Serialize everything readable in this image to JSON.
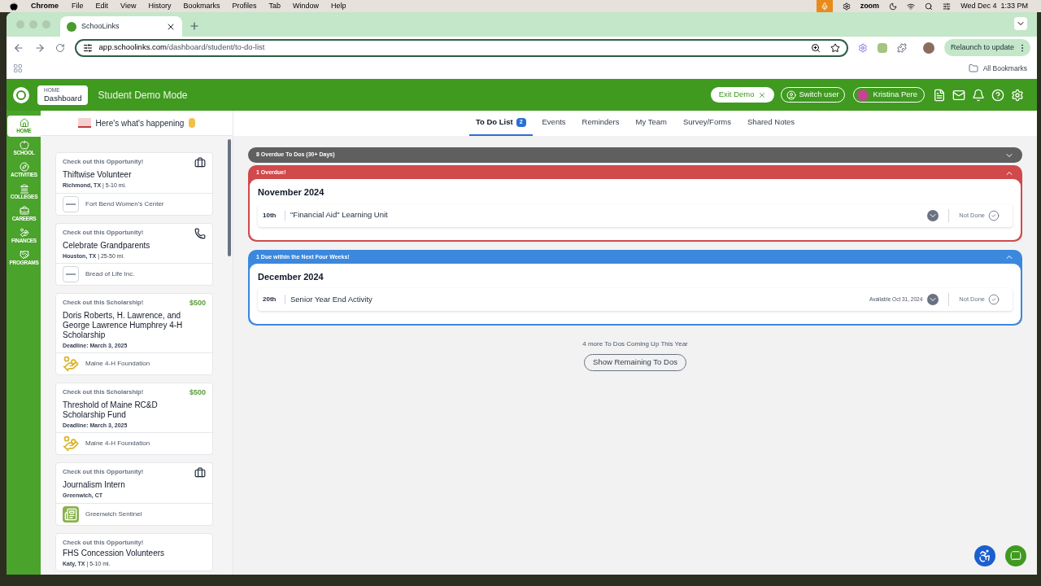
{
  "menu_bar": {
    "app": "Chrome",
    "items": [
      "File",
      "Edit",
      "View",
      "History",
      "Bookmarks",
      "Profiles",
      "Tab",
      "Window",
      "Help"
    ],
    "status_text": "zoom",
    "clock": "Wed Dec 4  1:33 PM"
  },
  "browser": {
    "tab_title": "SchooLinks",
    "url_host": "app.schoolinks.com",
    "url_path": "/dashboard/student/to-do-list",
    "relaunch": "Relaunch to update",
    "bookmarks": "All Bookmarks"
  },
  "header": {
    "crumb": "HOME",
    "page": "Dashboard",
    "mode": "Student Demo Mode",
    "exit": "Exit Demo",
    "switch_user": "Switch user",
    "user": "Kristina Pere"
  },
  "nav": [
    {
      "label": "HOME",
      "selected": true
    },
    {
      "label": "SCHOOL",
      "selected": false
    },
    {
      "label": "ACTIVITIES",
      "selected": false
    },
    {
      "label": "COLLEGES",
      "selected": false
    },
    {
      "label": "CAREERS",
      "selected": false
    },
    {
      "label": "FINANCES",
      "selected": false
    },
    {
      "label": "PROGRAMS",
      "selected": false
    }
  ],
  "feed": {
    "title": "Here's what's happening",
    "cards": [
      {
        "kind": "opportunity",
        "heading": "Check out this Opportunity!",
        "title": "Thiftwise Volunteer",
        "place": "Richmond, TX",
        "distance": "| 5-10 mi.",
        "org": "Fort Bend Women's Center"
      },
      {
        "kind": "opportunity",
        "heading": "Check out this Opportunity!",
        "title": "Celebrate Grandparents",
        "place": "Houston, TX",
        "distance": "| 25-50 mi.",
        "org": "Bread of Life Inc."
      },
      {
        "kind": "scholarship",
        "heading": "Check out this Scholarship!",
        "amount": "$500",
        "title": "Doris Roberts, H. Lawrence, and George Lawrence Humphrey 4-H Scholarship",
        "place": "Deadline: March 3, 2025",
        "org": "Maine 4-H Foundation"
      },
      {
        "kind": "scholarship",
        "heading": "Check out this Scholarship!",
        "amount": "$500",
        "title": "Threshold of Maine RC&D Scholarship Fund",
        "place": "Deadline: March 3, 2025",
        "org": "Maine 4-H Foundation"
      },
      {
        "kind": "opportunity",
        "heading": "Check out this Opportunity!",
        "title": "Journalism Intern",
        "place": "Greenwich, CT",
        "org": "Greenwich Sentinel"
      },
      {
        "kind": "opportunity",
        "heading": "Check out this Opportunity!",
        "title": "FHS Concession Volunteers",
        "place": "Katy, TX",
        "distance": "| 5-10 mi."
      }
    ]
  },
  "tabs": [
    {
      "label": "To Do List",
      "count": "2",
      "selected": true
    },
    {
      "label": "Events",
      "selected": false
    },
    {
      "label": "Reminders",
      "selected": false
    },
    {
      "label": "My Team",
      "selected": false
    },
    {
      "label": "Survey/Forms",
      "selected": false
    },
    {
      "label": "Shared Notes",
      "selected": false
    }
  ],
  "sections": [
    {
      "header": "8 Overdue To Dos (30+ Days)",
      "color": "#5f5f5f",
      "expanded": false
    },
    {
      "header": "1 Overdue!",
      "color": "#d0494b",
      "expanded": true,
      "month": "November 2024",
      "items": [
        {
          "day": "10th",
          "title": "\"Financial Aid\" Learning Unit",
          "status": "Not Done"
        }
      ]
    },
    {
      "header": "1 Due within the Next Four Weeks!",
      "color": "#3b88dd",
      "expanded": true,
      "month": "December 2024",
      "items": [
        {
          "day": "20th",
          "title": "Senior Year End Activity",
          "available": "Available Oct 31, 2024",
          "status": "Not Done"
        }
      ]
    }
  ],
  "more": {
    "text": "4 more To Dos Coming Up This Year",
    "button": "Show Remaining To Dos"
  }
}
